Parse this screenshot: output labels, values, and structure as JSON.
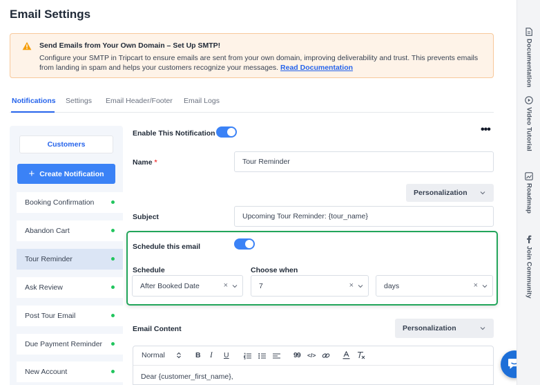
{
  "page_title": "Email Settings",
  "notice": {
    "title": "Send Emails from Your Own Domain – Set Up SMTP!",
    "body": "Configure your SMTP in Tripcart to ensure emails are sent from your own domain, improving deliverability and trust. This prevents emails from landing in spam and helps your customers recognize your messages.",
    "link": "Read Documentation",
    "accent_color": "#f59e0b"
  },
  "tabs": [
    "Notifications",
    "Settings",
    "Email Header/Footer",
    "Email Logs"
  ],
  "active_tab": "Notifications",
  "sidebar": {
    "customers_label": "Customers",
    "create_label": "Create Notification",
    "items": [
      {
        "label": "Booking Confirmation",
        "active": false
      },
      {
        "label": "Abandon Cart",
        "active": false
      },
      {
        "label": "Tour Reminder",
        "active": true
      },
      {
        "label": "Ask Review",
        "active": false
      },
      {
        "label": "Post Tour Email",
        "active": false
      },
      {
        "label": "Due Payment Reminder",
        "active": false
      },
      {
        "label": "New Account",
        "active": false
      }
    ],
    "status_color": "#22c55e"
  },
  "form": {
    "enable_label": "Enable This Notification",
    "enable_on": true,
    "name_label": "Name",
    "required_mark": "*",
    "name_value": "Tour Reminder",
    "personalization_label": "Personalization",
    "subject_label": "Subject",
    "subject_value": "Upcoming Tour Reminder: {tour_name}",
    "schedule_this_label": "Schedule this email",
    "schedule_on": true,
    "schedule_label": "Schedule",
    "schedule_value": "After Booked Date",
    "choose_when_label": "Choose when",
    "choose_when_value": "7",
    "unit_value": "days",
    "clear_glyph": "×",
    "email_content_label": "Email Content",
    "personalization_label_2": "Personalization"
  },
  "editor": {
    "format_value": "Normal",
    "bold": "B",
    "italic": "I",
    "underline": "U",
    "quote": "99",
    "code": "</>",
    "content": "Dear {customer_first_name},"
  },
  "rightbar": {
    "items": [
      {
        "label": "Documentation",
        "icon": "document-icon"
      },
      {
        "label": "Video Tutorial",
        "icon": "play-circle-icon"
      },
      {
        "label": "Roadmap",
        "icon": "map-icon"
      },
      {
        "label": "Join Community",
        "icon": "facebook-icon"
      }
    ]
  },
  "colors": {
    "primary": "#3b82f6",
    "success_border": "#22a55a",
    "chat_button": "#1d6fd8"
  }
}
